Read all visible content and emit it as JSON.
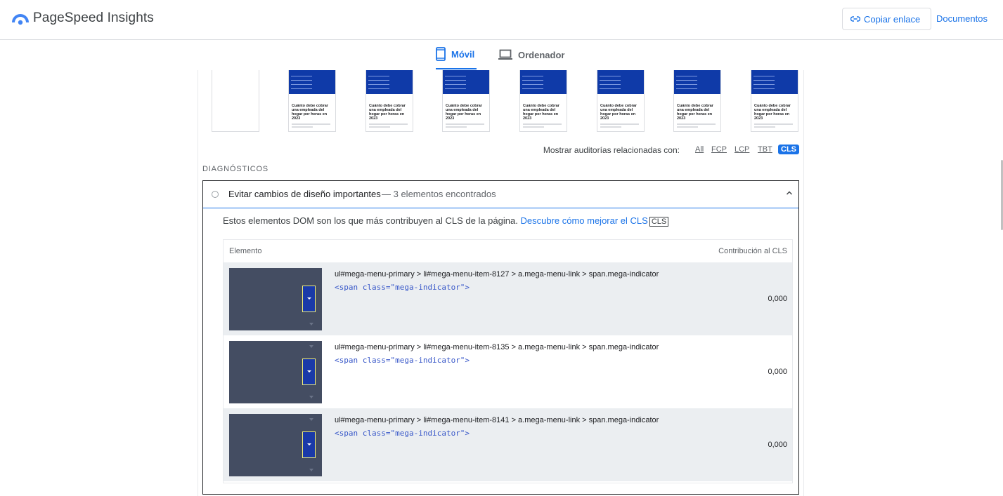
{
  "header": {
    "app_title": "PageSpeed Insights",
    "copy_link_label": "Copiar enlace",
    "docs_label": "Documentos"
  },
  "tabs": [
    {
      "label": "Móvil",
      "active": true
    },
    {
      "label": "Ordenador",
      "active": false
    }
  ],
  "filmstrip": {
    "frame_title": "Cuánto debe cobrar una empleada del hogar por horas en 2023"
  },
  "audit_filter": {
    "label": "Mostrar auditorías relacionadas con:",
    "chips": [
      "All",
      "FCP",
      "LCP",
      "TBT",
      "CLS"
    ],
    "active_chip": "CLS"
  },
  "diagnostics": {
    "heading": "DIAGNÓSTICOS"
  },
  "audit": {
    "title": "Evitar cambios de diseño importantes",
    "count": "— 3 elementos encontrados",
    "description": "Estos elementos DOM son los que más contribuyen al CLS de la página.",
    "link_text": "Descubre cómo mejorar el CLS",
    "badge": "CLS",
    "table": {
      "col_element": "Elemento",
      "col_contribution": "Contribución al CLS",
      "rows": [
        {
          "selector": "ul#mega-menu-primary > li#mega-menu-item-8127 > a.mega-menu-link > span.mega-indicator",
          "snippet": "<span class=\"mega-indicator\">",
          "value": "0,000"
        },
        {
          "selector": "ul#mega-menu-primary > li#mega-menu-item-8135 > a.mega-menu-link > span.mega-indicator",
          "snippet": "<span class=\"mega-indicator\">",
          "value": "0,000"
        },
        {
          "selector": "ul#mega-menu-primary > li#mega-menu-item-8141 > a.mega-menu-link > span.mega-indicator",
          "snippet": "<span class=\"mega-indicator\">",
          "value": "0,000"
        }
      ]
    }
  },
  "colors": {
    "accent": "#1a73e8",
    "highlight_border": "#f3f07a",
    "screenshot_bg": "#444d62"
  }
}
